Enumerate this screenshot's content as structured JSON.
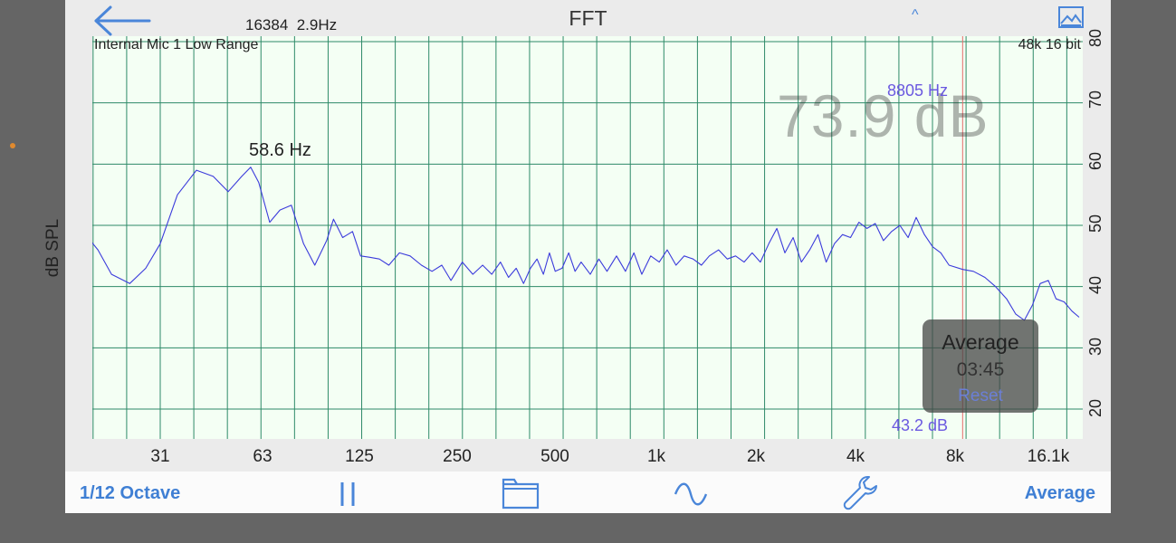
{
  "header": {
    "title": "FFT",
    "fft_info": "16384  2.9Hz",
    "caret": "^"
  },
  "plot": {
    "source_label": "Internal Mic 1 Low Range",
    "format_label": "48k 16 bit",
    "big_reading": "73.9 dB",
    "cursor_freq": "8805 Hz",
    "cursor_db": "43.2 dB",
    "peak_label": "58.6 Hz",
    "ylabel": "dB SPL",
    "y_ticks": [
      "80",
      "70",
      "60",
      "50",
      "40",
      "30",
      "20"
    ],
    "x_ticks": [
      "31",
      "63",
      "125",
      "250",
      "500",
      "1k",
      "2k",
      "4k",
      "8k",
      "16.1k"
    ]
  },
  "average_panel": {
    "title": "Average",
    "time": "03:45",
    "reset": "Reset"
  },
  "toolbar": {
    "octave": "1/12 Octave",
    "average": "Average"
  },
  "colors": {
    "trace": "#3b3bdb",
    "grid": "#2e8a68",
    "cursor_line": "#e66a6a",
    "accent": "#3f7fd4"
  },
  "icons": [
    "back-arrow-icon",
    "caret-up-icon",
    "image-icon",
    "pause-icon",
    "folder-icon",
    "wave-icon",
    "wrench-icon"
  ],
  "chart_data": {
    "type": "line",
    "xlabel": "",
    "ylabel": "dB SPL",
    "x_scale": "log2",
    "x_tick_values": [
      31,
      63,
      125,
      250,
      500,
      1000,
      2000,
      4000,
      8000,
      16100
    ],
    "x_tick_labels": [
      "31",
      "63",
      "125",
      "250",
      "500",
      "1k",
      "2k",
      "4k",
      "8k",
      "16.1k"
    ],
    "xlim": [
      16,
      20000
    ],
    "ylim": [
      14.5,
      81
    ],
    "y_ticks": [
      20,
      30,
      40,
      50,
      60,
      70,
      80
    ],
    "grid": true,
    "cursor": {
      "freq": 8805,
      "db": 43.2
    },
    "peak": {
      "freq": 58.6,
      "label": "58.6 Hz"
    },
    "series": [
      {
        "x": [
          16,
          18,
          20,
          22,
          25,
          28,
          31,
          35,
          40,
          45,
          50,
          55,
          58.6,
          62,
          67,
          72,
          78,
          85,
          92,
          100,
          105,
          112,
          120,
          127,
          135,
          145,
          155,
          167,
          180,
          195,
          210,
          225,
          240,
          260,
          280,
          300,
          320,
          340,
          360,
          380,
          400,
          420,
          440,
          460,
          480,
          500,
          525,
          550,
          575,
          600,
          640,
          680,
          720,
          770,
          820,
          870,
          920,
          980,
          1040,
          1100,
          1170,
          1240,
          1320,
          1400,
          1480,
          1580,
          1680,
          1780,
          1890,
          2000,
          2120,
          2250,
          2380,
          2520,
          2670,
          2830,
          3000,
          3180,
          3370,
          3570,
          3780,
          4000,
          4240,
          4490,
          4760,
          5040,
          5340,
          5660,
          6000,
          6350,
          6730,
          7130,
          7550,
          8000,
          8805,
          9500,
          10300,
          11100,
          12000,
          12800,
          13600,
          14400,
          15200,
          16100,
          17000,
          18000,
          19000,
          20000
        ],
        "values": [
          50,
          49,
          46,
          42,
          40.5,
          43,
          47,
          55,
          59,
          58,
          55.5,
          58,
          59.5,
          57,
          50.5,
          52.5,
          53.3,
          47,
          43.5,
          47.5,
          51,
          48,
          49,
          45,
          44.8,
          44.5,
          43.5,
          45.5,
          45,
          43.5,
          42.5,
          43.5,
          41,
          44,
          42,
          43.5,
          42,
          44,
          41.5,
          43,
          40.5,
          43,
          44.5,
          42,
          45.5,
          42.5,
          43,
          45.5,
          42.5,
          44,
          42,
          44.5,
          42.5,
          45,
          42.5,
          45.5,
          42,
          45,
          44,
          46,
          43.5,
          45,
          44.5,
          43.5,
          45,
          46,
          44.5,
          45,
          44,
          45.5,
          44,
          47,
          49.5,
          45.5,
          48,
          44,
          46,
          48.5,
          44,
          47,
          48.5,
          48,
          50.5,
          49.5,
          50.3,
          47.5,
          49,
          50,
          48,
          51.3,
          48.5,
          46.5,
          45.5,
          43.5,
          42.8,
          42.5,
          41.5,
          40,
          38,
          35.5,
          34.5,
          37,
          40.5,
          41,
          38,
          37.5,
          36,
          35
        ]
      }
    ]
  }
}
